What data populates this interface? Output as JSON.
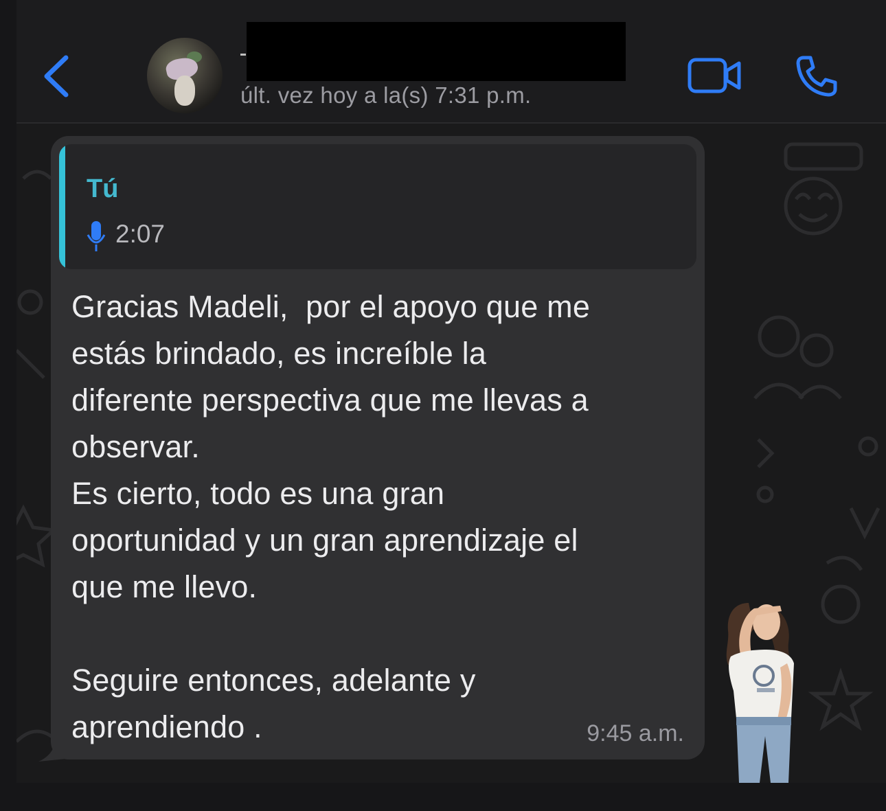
{
  "header": {
    "back_icon": "chevron-left-icon",
    "contact_name": "-",
    "last_seen": "últ. vez hoy a la(s) 7:31 p.m.",
    "video_icon": "video-camera-icon",
    "call_icon": "phone-icon",
    "accent_color": "#2f7cf6"
  },
  "message": {
    "quote": {
      "author": "Tú",
      "icon": "microphone-icon",
      "duration": "2:07",
      "bar_color": "#35c2d8"
    },
    "text": "Gracias Madeli,  por el apoyo que me\nestás brindado, es increíble la\ndiferente perspectiva que me llevas a\nobservar.\nEs cierto, todo es una gran\noportunidad y un gran aprendizaje el\nque me llevo.\n\nSeguire entonces, adelante y\naprendiendo .",
    "time": "9:45 a.m."
  },
  "sticker": {
    "icon": "woman-looking-sticker"
  }
}
